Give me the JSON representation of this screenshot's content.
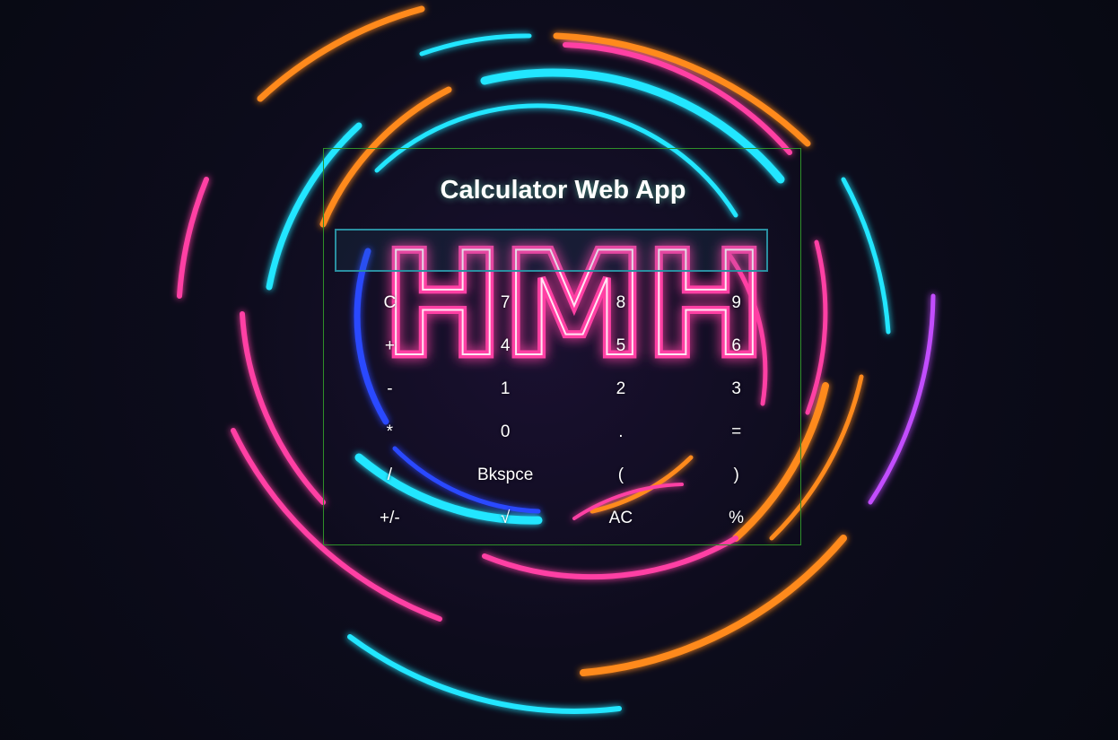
{
  "app": {
    "title": "Calculator Web App",
    "display_value": "",
    "background_logo": "HMH"
  },
  "keypad": {
    "rows": [
      [
        "C",
        "7",
        "8",
        "9"
      ],
      [
        "+",
        "4",
        "5",
        "6"
      ],
      [
        "-",
        "1",
        "2",
        "3"
      ],
      [
        "*",
        "0",
        ".",
        "="
      ],
      [
        "/",
        "Bkspce",
        "(",
        ")"
      ],
      [
        "+/-",
        "√",
        "AC",
        "%"
      ]
    ]
  },
  "colors": {
    "frame_border": "#2f8f2a",
    "display_border": "#2a8ea0",
    "text": "#ffffff",
    "neon_pink": "#ff3fa4",
    "neon_cyan": "#22e6ff",
    "neon_orange": "#ff8a1f",
    "neon_blue": "#2a48ff",
    "background": "#0a0d17"
  }
}
